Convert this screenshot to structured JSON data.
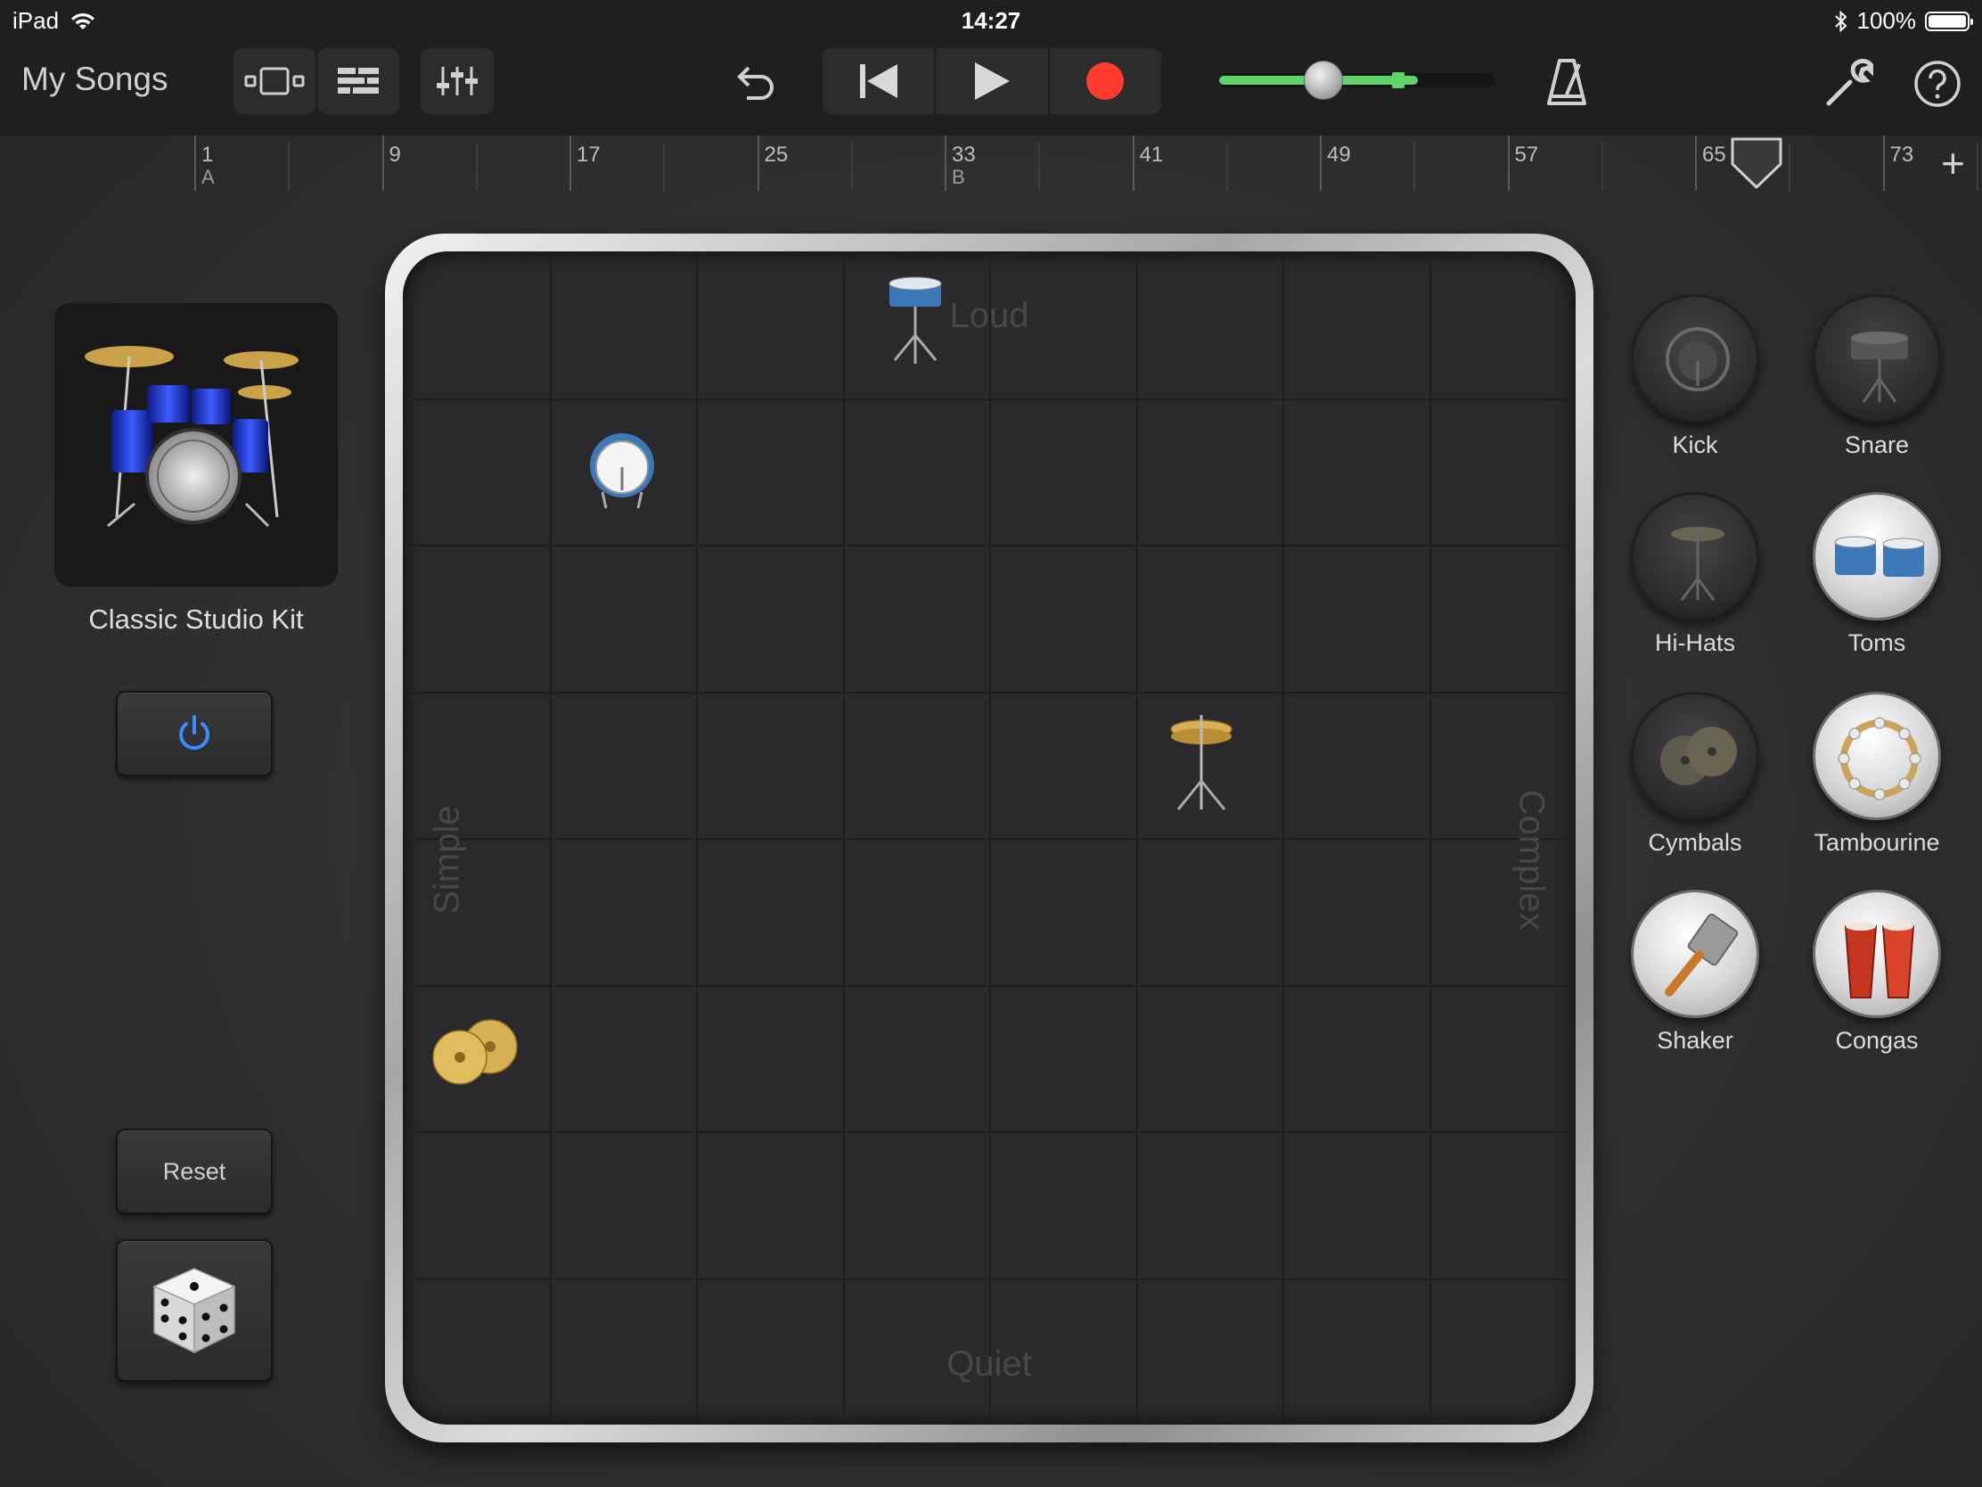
{
  "status": {
    "device": "iPad",
    "time": "14:27",
    "battery": "100%"
  },
  "toolbar": {
    "my_songs": "My Songs",
    "volume_level": 0.28
  },
  "ruler": {
    "bars": [
      {
        "num": "1",
        "mark": "A"
      },
      {
        "num": "9",
        "mark": ""
      },
      {
        "num": "17",
        "mark": ""
      },
      {
        "num": "25",
        "mark": ""
      },
      {
        "num": "33",
        "mark": "B"
      },
      {
        "num": "41",
        "mark": ""
      },
      {
        "num": "49",
        "mark": ""
      },
      {
        "num": "57",
        "mark": ""
      },
      {
        "num": "65",
        "mark": ""
      },
      {
        "num": "73",
        "mark": ""
      }
    ]
  },
  "kit": {
    "name": "Classic Studio Kit",
    "reset_label": "Reset"
  },
  "pad": {
    "loud": "Loud",
    "quiet": "Quiet",
    "simple": "Simple",
    "complex": "Complex"
  },
  "instruments": [
    {
      "label": "Kick",
      "icon": "kick-drum-icon",
      "active": false
    },
    {
      "label": "Snare",
      "icon": "snare-drum-icon",
      "active": false
    },
    {
      "label": "Hi-Hats",
      "icon": "hihat-icon",
      "active": false
    },
    {
      "label": "Toms",
      "icon": "toms-icon",
      "active": true
    },
    {
      "label": "Cymbals",
      "icon": "cymbals-icon",
      "active": false
    },
    {
      "label": "Tambourine",
      "icon": "tambourine-icon",
      "active": true
    },
    {
      "label": "Shaker",
      "icon": "shaker-icon",
      "active": true
    },
    {
      "label": "Congas",
      "icon": "congas-icon",
      "active": true
    }
  ],
  "colors": {
    "accent_green": "#5ed46a",
    "record_red": "#ff3b30",
    "power_blue": "#3b8cff"
  }
}
